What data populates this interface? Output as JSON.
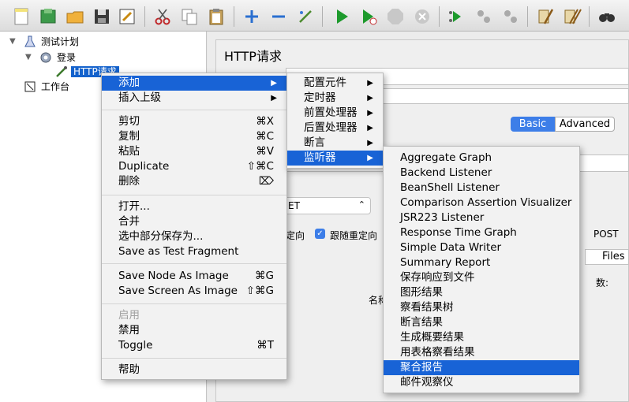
{
  "toolbar": {
    "buttons": [
      "new-icon",
      "templates-icon",
      "open-icon",
      "save-icon",
      "edit-icon",
      "cut-icon",
      "copy-icon",
      "paste-icon",
      "expand-icon",
      "collapse-icon",
      "toggle-icon",
      "start-icon",
      "start-no-pauses-icon",
      "stop-icon",
      "shutdown-icon",
      "remote-start-icon",
      "remote-stop-icon",
      "remote-shutdown-icon",
      "clear-icon",
      "clear-all-icon",
      "search-icon"
    ]
  },
  "tree": {
    "root": "测试计划",
    "child": "登录",
    "selected": "HTTP请求",
    "workbench": "工作台"
  },
  "editor": {
    "title": "HTTP请求",
    "tab_basic": "Basic",
    "tab_advanced": "Advanced",
    "method_value": "ET",
    "redirect_label": "定向",
    "follow_redirect_label": "跟随重定向",
    "post_label": "POST",
    "files_label": "Files",
    "count_label": "数:",
    "name_label": "名称"
  },
  "context_menu": {
    "items": [
      {
        "label": "添加",
        "shortcut": "",
        "submenu": true,
        "highlight": true
      },
      {
        "label": "插入上级",
        "shortcut": "",
        "submenu": true
      },
      {
        "label": "剪切",
        "shortcut": "⌘X"
      },
      {
        "label": "复制",
        "shortcut": "⌘C"
      },
      {
        "label": "粘贴",
        "shortcut": "⌘V"
      },
      {
        "label": "Duplicate",
        "shortcut": "⇧⌘C"
      },
      {
        "label": "删除",
        "shortcut": "⌦"
      },
      {
        "label": "打开...",
        "shortcut": ""
      },
      {
        "label": "合并",
        "shortcut": ""
      },
      {
        "label": "选中部分保存为...",
        "shortcut": ""
      },
      {
        "label": "Save as Test Fragment",
        "shortcut": ""
      },
      {
        "label": "Save Node As Image",
        "shortcut": "⌘G"
      },
      {
        "label": "Save Screen As Image",
        "shortcut": "⇧⌘G"
      },
      {
        "label": "启用",
        "shortcut": "",
        "disabled": true
      },
      {
        "label": "禁用",
        "shortcut": ""
      },
      {
        "label": "Toggle",
        "shortcut": "⌘T"
      },
      {
        "label": "帮助",
        "shortcut": ""
      }
    ]
  },
  "add_submenu": {
    "items": [
      "配置元件",
      "定时器",
      "前置处理器",
      "后置处理器",
      "断言",
      "监听器"
    ]
  },
  "listener_submenu": {
    "items": [
      "Aggregate Graph",
      "Backend Listener",
      "BeanShell Listener",
      "Comparison Assertion Visualizer",
      "JSR223 Listener",
      "Response Time Graph",
      "Simple Data Writer",
      "Summary Report",
      "保存响应到文件",
      "图形结果",
      "察看结果树",
      "断言结果",
      "生成概要结果",
      "用表格察看结果",
      "聚合报告",
      "邮件观察仪"
    ],
    "highlighted": "聚合报告"
  },
  "colors": {
    "highlight": "#1863d6",
    "selection": "#1462cc",
    "segment_active": "#3d7ee8"
  }
}
